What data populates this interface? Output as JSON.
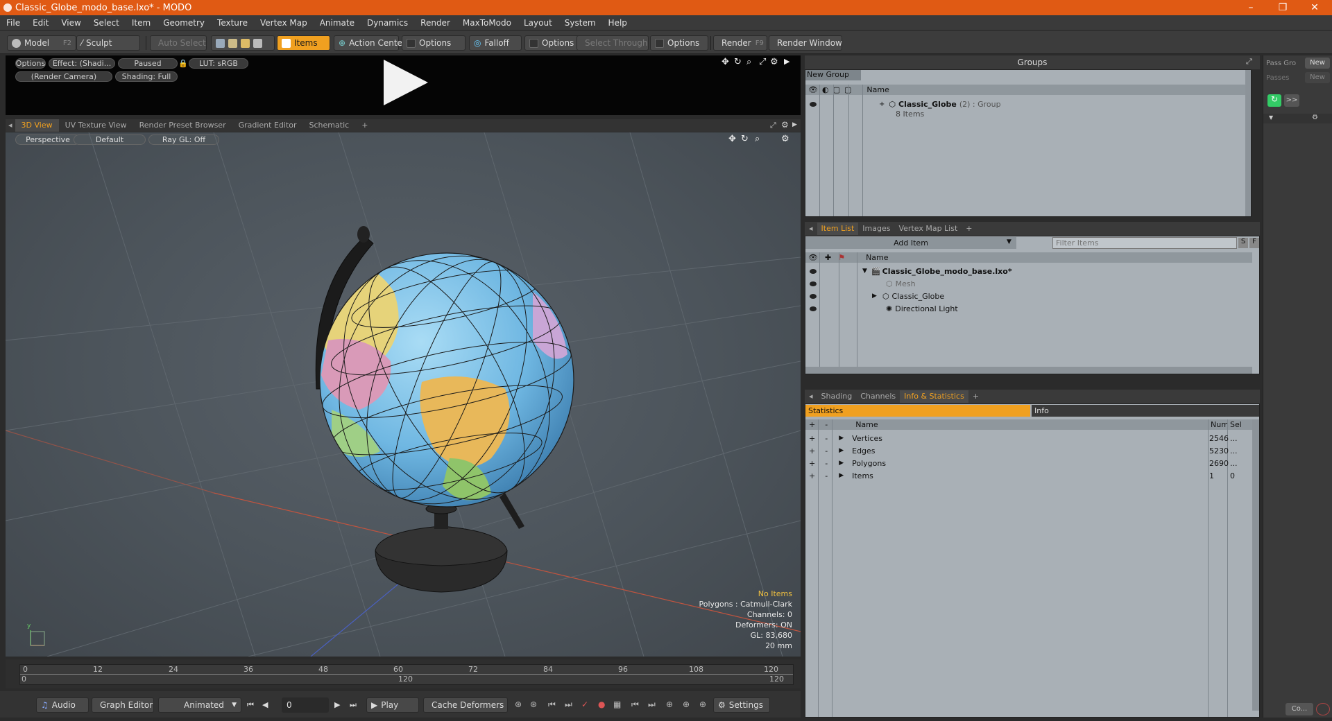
{
  "window": {
    "title": "Classic_Globe_modo_base.lxo* - MODO",
    "minimize": "–",
    "maximize": "❐",
    "close": "✕"
  },
  "menu": [
    "File",
    "Edit",
    "View",
    "Select",
    "Item",
    "Geometry",
    "Texture",
    "Vertex Map",
    "Animate",
    "Dynamics",
    "Render",
    "MaxToModo",
    "Layout",
    "System",
    "Help"
  ],
  "toolbar": {
    "model": "Model",
    "model_key": "F2",
    "sculpt": "Sculpt",
    "auto_select": "Auto Select",
    "items": "Items",
    "action_center": "Action Center",
    "options1": "Options",
    "falloff": "Falloff",
    "options2": "Options",
    "select_through": "Select Through",
    "options3": "Options",
    "render": "Render",
    "render_key": "F9",
    "render_window": "Render Window"
  },
  "preview": {
    "options": "Options",
    "effect": "Effect: (Shadi...",
    "paused": "Paused",
    "lut": "LUT: sRGB",
    "camera": "(Render Camera)",
    "shading": "Shading: Full"
  },
  "viewport_tabs": [
    "3D View",
    "UV Texture View",
    "Render Preset Browser",
    "Gradient Editor",
    "Schematic",
    "+"
  ],
  "viewport": {
    "perspective": "Perspective",
    "default": "Default",
    "raygl": "Ray GL: Off",
    "info": {
      "no_items": "No Items",
      "polygons": "Polygons : Catmull-Clark",
      "channels": "Channels: 0",
      "deformers": "Deformers: ON",
      "gl": "GL: 83,680",
      "size": "20 mm"
    }
  },
  "timeline": {
    "ticks": [
      "0",
      "12",
      "24",
      "36",
      "48",
      "60",
      "72",
      "84",
      "96",
      "108",
      "120"
    ],
    "lower": [
      "0",
      "120",
      "120"
    ]
  },
  "bottombar": {
    "audio": "Audio",
    "graph_editor": "Graph Editor",
    "animated": "Animated",
    "frame": "0",
    "play": "Play",
    "cache_deformers": "Cache Deformers",
    "settings": "Settings"
  },
  "groups": {
    "title": "Groups",
    "new_group": "New Group",
    "col_name": "Name",
    "item_name": "Classic_Globe",
    "item_suffix": "(2) : Group",
    "item_count": "8 Items"
  },
  "far_right": {
    "pass_groups": "Pass Gro",
    "passes": "Passes",
    "new1": "New",
    "new2": "New",
    "expand": ">>",
    "co": "Co..."
  },
  "itemlist": {
    "tabs": [
      "Item List",
      "Images",
      "Vertex Map List",
      "+"
    ],
    "add_item": "Add Item",
    "filter_placeholder": "Filter Items",
    "s": "S",
    "f": "F",
    "col_name": "Name",
    "items": [
      "Classic_Globe_modo_base.lxo*",
      "Mesh",
      "Classic_Globe",
      "Directional Light"
    ]
  },
  "stats": {
    "tabs": [
      "Shading",
      "Channels",
      "Info & Statistics",
      "+"
    ],
    "statistics": "Statistics",
    "info": "Info",
    "col_name": "Name",
    "col_num": "Num",
    "col_sel": "Sel",
    "rows": [
      {
        "name": "Vertices",
        "num": "2546",
        "sel": "..."
      },
      {
        "name": "Edges",
        "num": "5230",
        "sel": "..."
      },
      {
        "name": "Polygons",
        "num": "2690",
        "sel": "..."
      },
      {
        "name": "Items",
        "num": "1",
        "sel": "0"
      }
    ]
  },
  "colors": {
    "titlebar": "#e05a14",
    "accent": "#f0a020"
  }
}
